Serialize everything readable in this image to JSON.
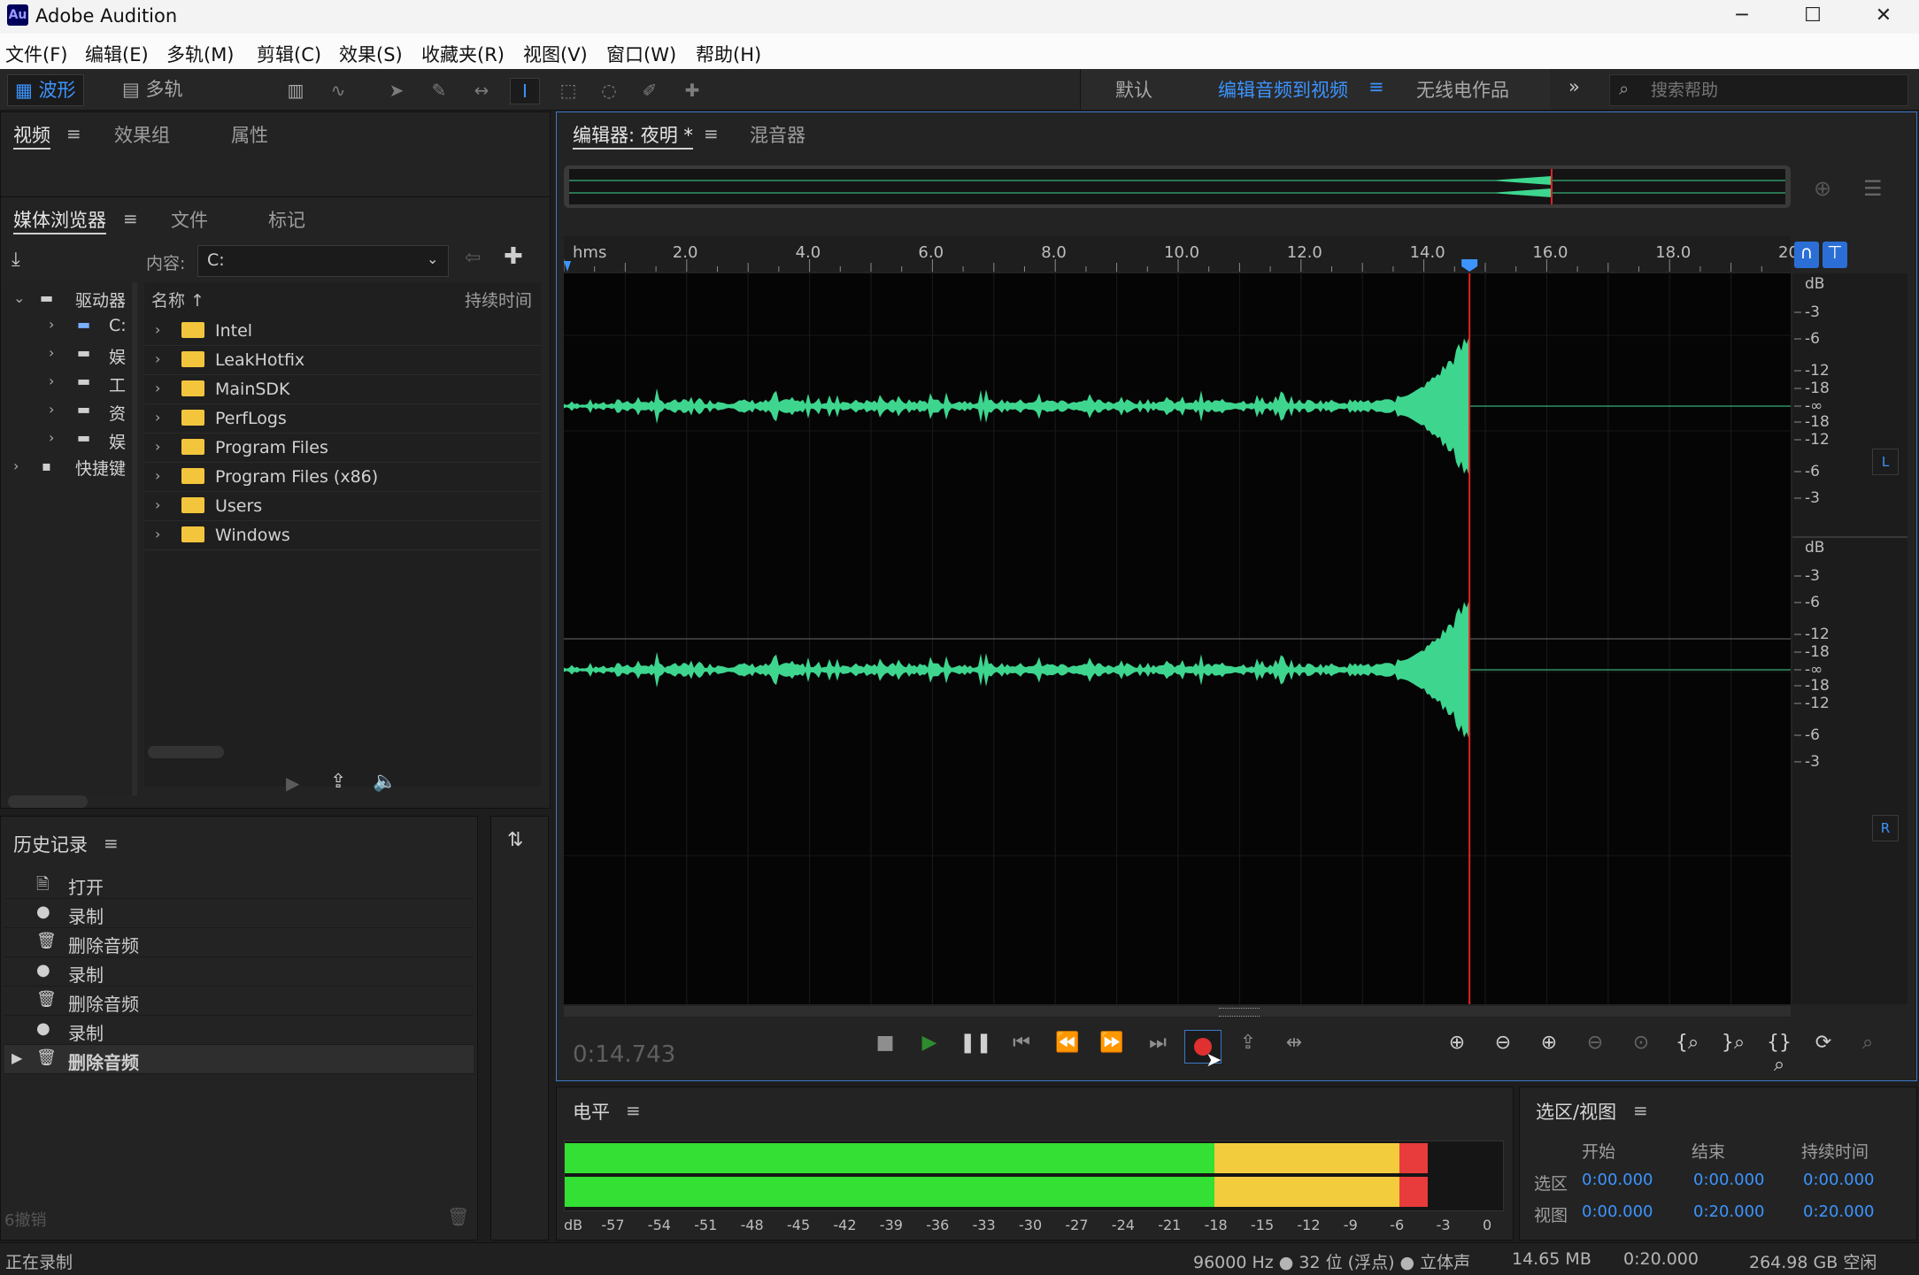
{
  "app": {
    "logo": "Au",
    "title": "Adobe Audition"
  },
  "window_controls": {
    "minimize": "─",
    "maximize": "☐",
    "close": "✕"
  },
  "menu": [
    "文件(F)",
    "编辑(E)",
    "多轨(M)",
    "剪辑(C)",
    "效果(S)",
    "收藏夹(R)",
    "视图(V)",
    "窗口(W)",
    "帮助(H)"
  ],
  "toolbar": {
    "mode_waveform": "波形",
    "mode_multitrack": "多轨",
    "workspaces": [
      "默认",
      "编辑音频到视频",
      "无线电作品"
    ],
    "overflow": "»",
    "search_placeholder": "搜索帮助"
  },
  "top_left_panel": {
    "tabs": [
      "视频",
      "效果组",
      "属性"
    ]
  },
  "media_browser": {
    "tabs": [
      "媒体浏览器",
      "文件",
      "标记"
    ],
    "content_label": "内容:",
    "content_value": "C:",
    "tree": [
      {
        "label": "驱动器",
        "icon": "drive-icon"
      },
      {
        "label": "C:",
        "icon": "drive-c-icon"
      },
      {
        "label": "娱",
        "icon": "drive-icon"
      },
      {
        "label": "工",
        "icon": "drive-icon"
      },
      {
        "label": "资",
        "icon": "drive-icon"
      },
      {
        "label": "娱",
        "icon": "drive-icon"
      },
      {
        "label": "快捷键",
        "icon": "shortcut-icon"
      }
    ],
    "col_name": "名称",
    "col_duration": "持续时间",
    "files": [
      "Intel",
      "LeakHotfix",
      "MainSDK",
      "PerfLogs",
      "Program Files",
      "Program Files (x86)",
      "Users",
      "Windows"
    ]
  },
  "history": {
    "title": "历史记录",
    "items": [
      {
        "icon": "open-icon",
        "label": "打开"
      },
      {
        "icon": "record-dot-icon",
        "label": "录制"
      },
      {
        "icon": "trash-icon",
        "label": "删除音频"
      },
      {
        "icon": "record-dot-icon",
        "label": "录制"
      },
      {
        "icon": "trash-icon",
        "label": "删除音频"
      },
      {
        "icon": "record-dot-icon",
        "label": "录制"
      },
      {
        "icon": "trash-icon",
        "label": "删除音频"
      }
    ],
    "undo_count": "6撤销"
  },
  "editor": {
    "tab": "编辑器: 夜明 *",
    "mixer_tab": "混音器",
    "ruler_unit": "hms",
    "ruler_labels": [
      "2.0",
      "4.0",
      "6.0",
      "8.0",
      "10.0",
      "12.0",
      "14.0",
      "16.0",
      "18.0",
      "20"
    ],
    "db_unit": "dB",
    "db_labels": [
      "-3",
      "-6",
      "-12",
      "-18",
      "-∞",
      "-18",
      "-12",
      "-6",
      "-3"
    ],
    "channel_left": "L",
    "channel_right": "R",
    "playhead_seconds": 14.743,
    "time_display": "0:14.743"
  },
  "levels": {
    "title": "电平",
    "scale": [
      "dB",
      "-57",
      "-54",
      "-51",
      "-48",
      "-45",
      "-42",
      "-39",
      "-36",
      "-33",
      "-30",
      "-27",
      "-24",
      "-21",
      "-18",
      "-15",
      "-12",
      "-9",
      "-6",
      "-3",
      "0"
    ],
    "colors": {
      "green": "#33e033",
      "yellow": "#f2cc3c",
      "red": "#e83b3b"
    }
  },
  "selection": {
    "title": "选区/视图",
    "col_start": "开始",
    "col_end": "结束",
    "col_duration": "持续时间",
    "row_selection": "选区",
    "row_view": "视图",
    "sel_start": "0:00.000",
    "sel_end": "0:00.000",
    "sel_duration": "0:00.000",
    "view_start": "0:00.000",
    "view_end": "0:20.000",
    "view_duration": "0:20.000"
  },
  "status": {
    "left": "正在录制",
    "sample_info": "96000 Hz ● 32 位 (浮点) ● 立体声",
    "size": "14.65 MB",
    "duration": "0:20.000",
    "free": "264.98 GB 空闲"
  },
  "colors": {
    "accent": "#3c94ff",
    "waveform": "#3ed68f",
    "playhead": "#e02020"
  }
}
